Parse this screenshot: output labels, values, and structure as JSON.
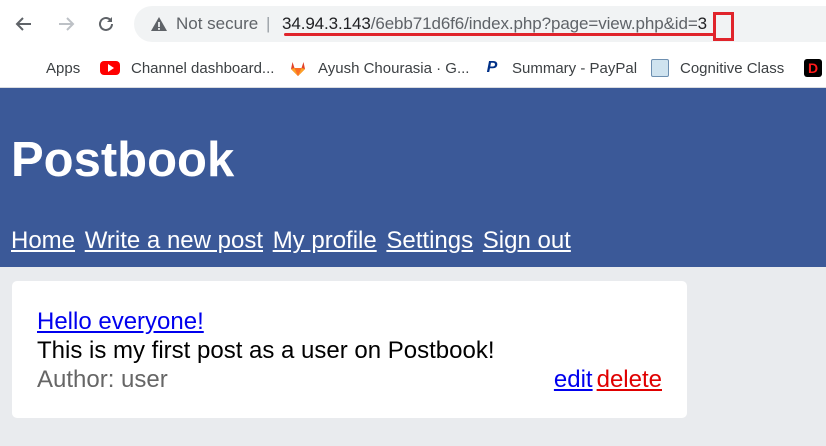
{
  "browser": {
    "security_label": "Not secure",
    "separator": "|",
    "url_host": "34.94.3.143",
    "url_path": "/6ebb71d6f6/index.php?page=view.php&id=",
    "url_id": "3",
    "bookmarks": [
      {
        "label": "Apps",
        "icon": "apps-grid-icon"
      },
      {
        "label": "Channel dashboard...",
        "icon": "youtube-icon"
      },
      {
        "label": "Ayush Chourasia · G...",
        "icon": "gitlab-icon"
      },
      {
        "label": "Summary - PayPal",
        "icon": "paypal-icon"
      },
      {
        "label": "Cognitive Class",
        "icon": "cognitive-class-icon"
      },
      {
        "label": "",
        "icon": "d-app-icon"
      }
    ],
    "highlight_color": "#e0242b"
  },
  "site": {
    "title": "Postbook",
    "header_color": "#3b5998",
    "nav": [
      "Home",
      "Write a new post",
      "My profile",
      "Settings",
      "Sign out"
    ]
  },
  "post": {
    "title": "Hello everyone!",
    "body": "This is my first post as a user on Postbook!",
    "author": "Author: user",
    "edit_label": "edit",
    "delete_label": "delete"
  }
}
